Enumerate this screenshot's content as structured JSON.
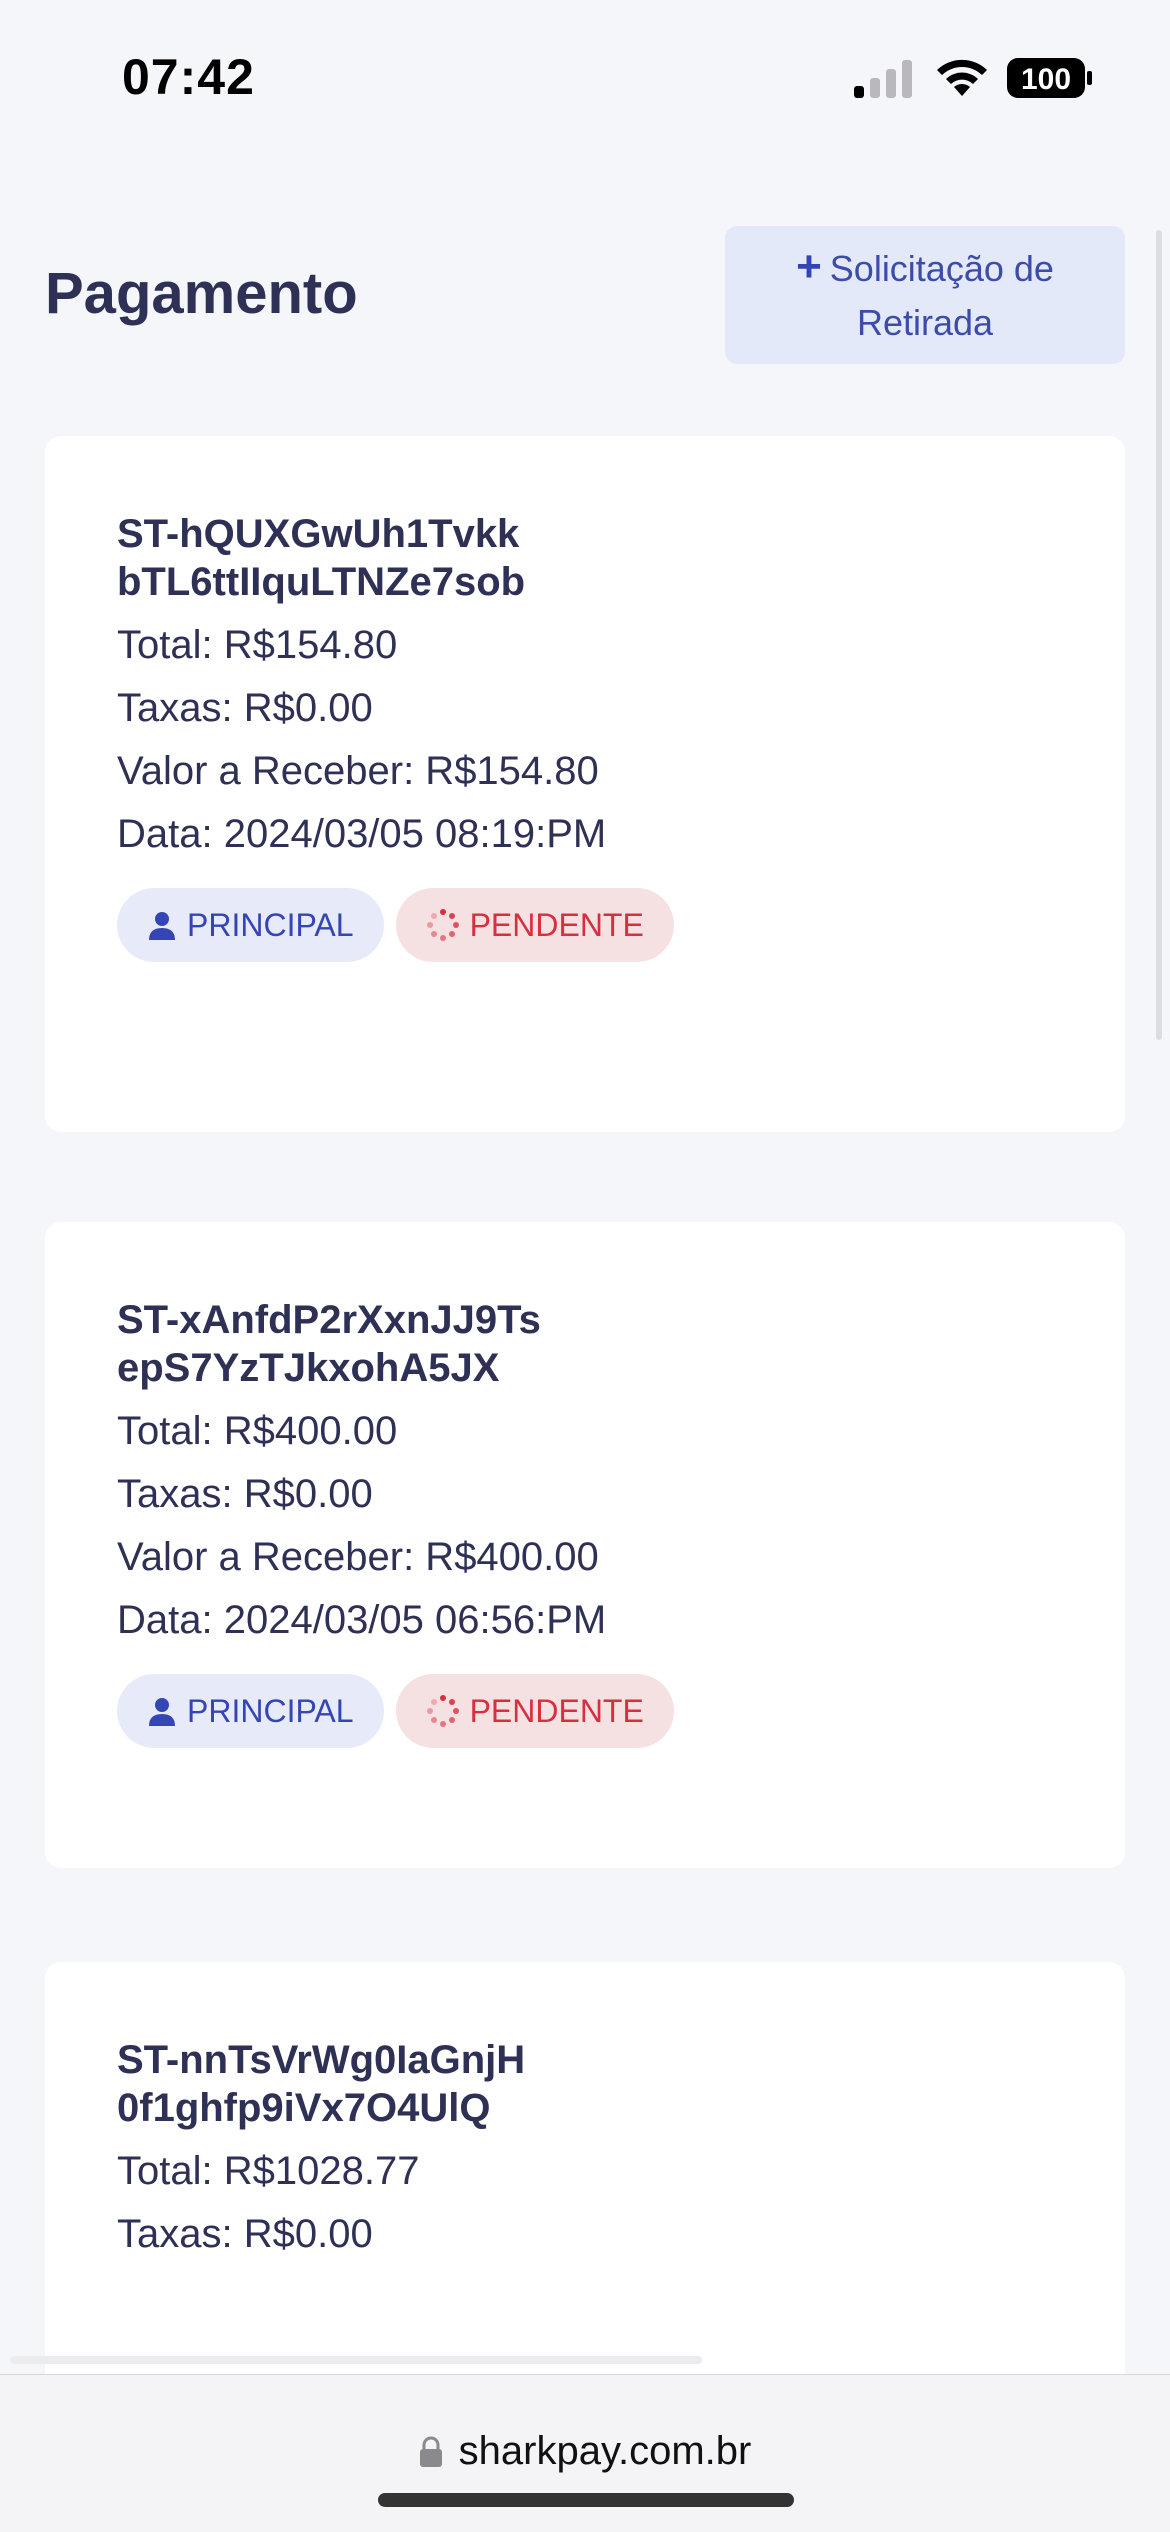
{
  "status_bar": {
    "time": "07:42",
    "battery": "100"
  },
  "header": {
    "title": "Pagamento",
    "withdraw_label_line1": "Solicitação de",
    "withdraw_label_line2": "Retirada"
  },
  "payments": [
    {
      "id": "ST-hQUXGwUh1TvkkbTL6ttIIquLTNZe7sob",
      "total": "Total: R$154.80",
      "fees": "Taxas: R$0.00",
      "receive": "Valor a Receber: R$154.80",
      "date": "Data: 2024/03/05 08:19:PM",
      "badge_account": "PRINCIPAL",
      "badge_status": "PENDENTE"
    },
    {
      "id": "ST-xAnfdP2rXxnJJ9TsepS7YzTJkxohA5JX",
      "total": "Total: R$400.00",
      "fees": "Taxas: R$0.00",
      "receive": "Valor a Receber: R$400.00",
      "date": "Data: 2024/03/05 06:56:PM",
      "badge_account": "PRINCIPAL",
      "badge_status": "PENDENTE"
    },
    {
      "id": "ST-nnTsVrWg0IaGnjH0f1ghfp9iVx7O4UlQ",
      "total": "Total: R$1028.77",
      "fees": "Taxas: R$0.00"
    }
  ],
  "browser": {
    "url": "sharkpay.com.br"
  }
}
